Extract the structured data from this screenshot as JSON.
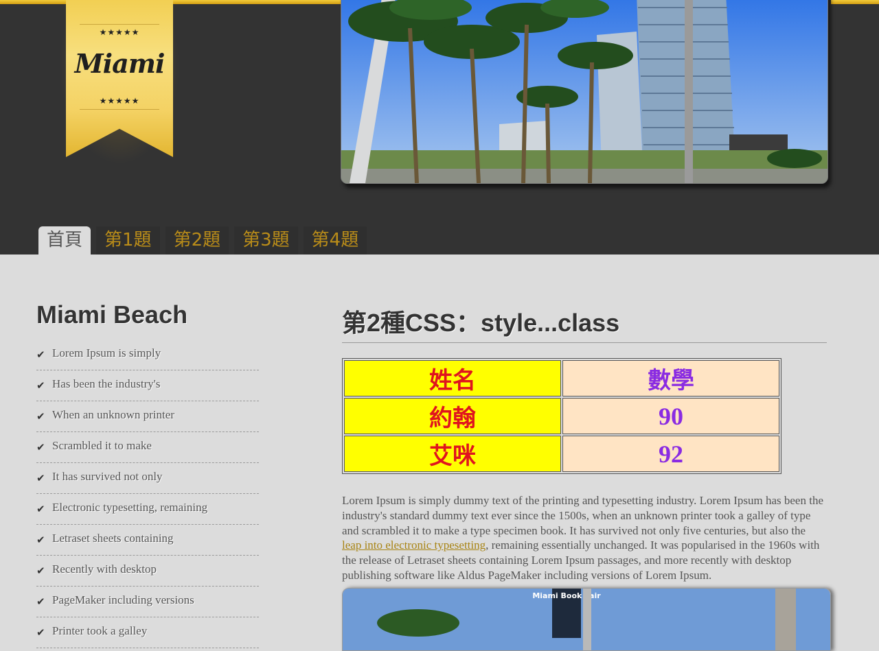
{
  "logo": {
    "text": "Miami",
    "stars_top": "★★★★★",
    "stars_bottom": "★★★★★"
  },
  "nav": {
    "tabs": [
      {
        "label": "首頁",
        "active": true
      },
      {
        "label": "第1題",
        "active": false
      },
      {
        "label": "第2題",
        "active": false
      },
      {
        "label": "第3題",
        "active": false
      },
      {
        "label": "第4題",
        "active": false
      }
    ]
  },
  "sidebar": {
    "title": "Miami Beach",
    "items": [
      "Lorem Ipsum is simply",
      "Has been the industry's",
      "When an unknown printer",
      "Scrambled it to make",
      "It has survived not only",
      "Electronic typesetting, remaining",
      "Letraset sheets containing",
      "Recently with desktop",
      "PageMaker including versions",
      "Printer took a galley"
    ]
  },
  "main": {
    "title": "第2種CSS：style...class",
    "table": {
      "header": [
        "姓名",
        "數學"
      ],
      "rows": [
        [
          "約翰",
          "90"
        ],
        [
          "艾咪",
          "92"
        ]
      ]
    },
    "paragraph": {
      "before": "Lorem Ipsum is simply dummy text of the printing and typesetting industry. Lorem Ipsum has been the industry's standard dummy text ever since the 1500s, when an unknown printer took a galley of type and scrambled it to make a type specimen book. It has survived not only five centuries, but also the ",
      "link": "leap into electronic typesetting",
      "after": ", remaining essentially unchanged. It was popularised in the 1960s with the release of Letraset sheets containing Lorem Ipsum passages, and more recently with desktop publishing software like Aldus PageMaker including versions of Lorem Ipsum."
    },
    "photo_sign": "Miami Book Fair"
  },
  "colors": {
    "accent": "#b98c19",
    "header_bg": "#333333",
    "page_bg": "#dcdcdc",
    "table_name_bg": "#ffff00",
    "table_name_fg": "#e0141e",
    "table_score_bg": "#ffe4c4",
    "table_score_fg": "#8a2be2"
  }
}
